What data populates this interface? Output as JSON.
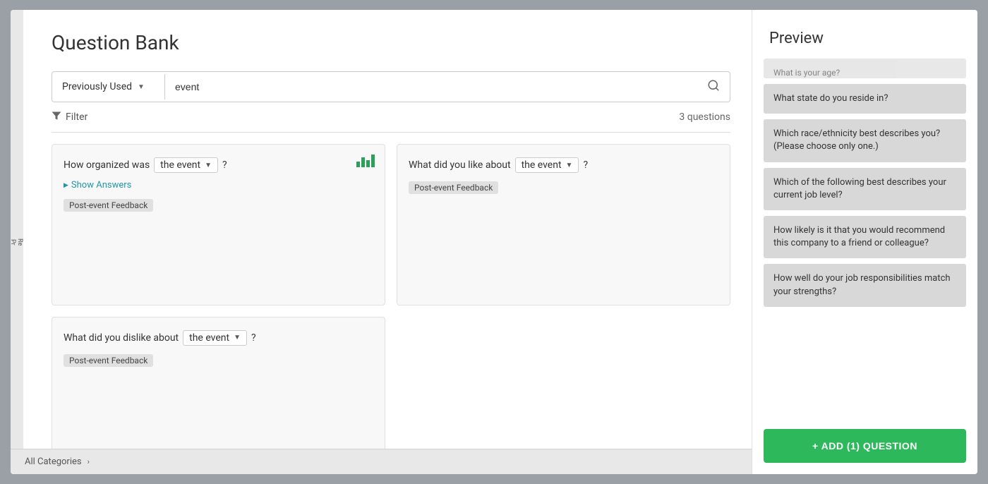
{
  "page": {
    "title": "Question Bank",
    "preview_title": "Preview"
  },
  "search": {
    "filter_label": "Previously Used",
    "filter_arrow": "▼",
    "input_value": "event",
    "question_count": "3 questions"
  },
  "filter": {
    "label": "Filter",
    "icon": "▼"
  },
  "questions": [
    {
      "prefix": "How organized was",
      "event_label": "the event",
      "suffix": "?",
      "has_chart": true,
      "show_answers_label": "Show Answers",
      "category": "Post-event Feedback"
    },
    {
      "prefix": "What did you like about",
      "event_label": "the event",
      "suffix": "?",
      "has_chart": false,
      "show_answers_label": null,
      "category": "Post-event Feedback"
    },
    {
      "prefix": "What did you dislike about",
      "event_label": "the event",
      "suffix": "?",
      "has_chart": false,
      "show_answers_label": null,
      "category": "Post-event Feedback"
    }
  ],
  "preview": {
    "items": [
      {
        "text": "What is your age?",
        "truncated": true
      },
      {
        "text": "What state do you reside in?"
      },
      {
        "text": "Which race/ethnicity best describes you? (Please choose only one.)"
      },
      {
        "text": "Which of the following best describes your current job level?"
      },
      {
        "text": "How likely is it that you would recommend this company to a friend or colleague?"
      },
      {
        "text": "How well do your job responsibilities match your strengths?"
      }
    ],
    "add_button_label": "+ ADD (1) QUESTION"
  },
  "bottom_bar": {
    "label": "All Categories",
    "arrow": "›"
  },
  "icons": {
    "search": "🔍",
    "filter": "▼",
    "bar_chart": "bar-chart",
    "show_answers_arrow": "▶"
  }
}
